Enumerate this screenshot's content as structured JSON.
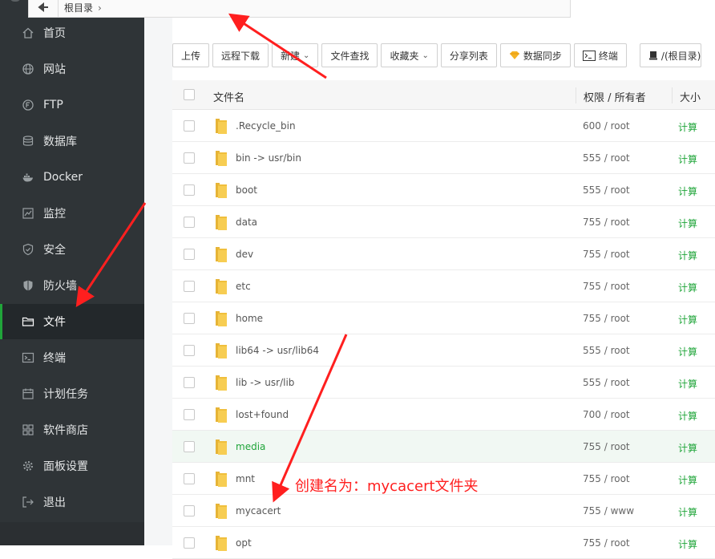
{
  "sidebar": {
    "items": [
      {
        "label": "首页",
        "icon": "home-icon"
      },
      {
        "label": "网站",
        "icon": "globe-icon"
      },
      {
        "label": "FTP",
        "icon": "ftp-icon"
      },
      {
        "label": "数据库",
        "icon": "database-icon"
      },
      {
        "label": "Docker",
        "icon": "docker-icon"
      },
      {
        "label": "监控",
        "icon": "monitor-icon"
      },
      {
        "label": "安全",
        "icon": "shield-icon"
      },
      {
        "label": "防火墙",
        "icon": "firewall-icon"
      },
      {
        "label": "文件",
        "icon": "folder-icon",
        "active": true
      },
      {
        "label": "终端",
        "icon": "terminal-icon"
      },
      {
        "label": "计划任务",
        "icon": "calendar-icon"
      },
      {
        "label": "软件商店",
        "icon": "apps-icon"
      },
      {
        "label": "面板设置",
        "icon": "gear-icon"
      },
      {
        "label": "退出",
        "icon": "logout-icon"
      }
    ]
  },
  "pathbar": {
    "root_label": "根目录"
  },
  "toolbar": {
    "upload": "上传",
    "remote_download": "远程下载",
    "new": "新建",
    "file_search": "文件查找",
    "favorites": "收藏夹",
    "share_list": "分享列表",
    "data_sync": "数据同步",
    "terminal": "终端",
    "disk": "/(根目录)"
  },
  "table": {
    "headers": {
      "name": "文件名",
      "perm": "权限 / 所有者",
      "size": "大小"
    },
    "rows": [
      {
        "name": ".Recycle_bin",
        "perm": "600 / root",
        "size": "计算"
      },
      {
        "name": "bin -> usr/bin",
        "perm": "555 / root",
        "size": "计算"
      },
      {
        "name": "boot",
        "perm": "555 / root",
        "size": "计算"
      },
      {
        "name": "data",
        "perm": "755 / root",
        "size": "计算"
      },
      {
        "name": "dev",
        "perm": "755 / root",
        "size": "计算"
      },
      {
        "name": "etc",
        "perm": "755 / root",
        "size": "计算"
      },
      {
        "name": "home",
        "perm": "755 / root",
        "size": "计算"
      },
      {
        "name": "lib64 -> usr/lib64",
        "perm": "555 / root",
        "size": "计算"
      },
      {
        "name": "lib -> usr/lib",
        "perm": "555 / root",
        "size": "计算"
      },
      {
        "name": "lost+found",
        "perm": "700 / root",
        "size": "计算"
      },
      {
        "name": "media",
        "perm": "755 / root",
        "size": "计算",
        "highlight": true
      },
      {
        "name": "mnt",
        "perm": "755 / root",
        "size": "计算"
      },
      {
        "name": "mycacert",
        "perm": "755 / www",
        "size": "计算"
      },
      {
        "name": "opt",
        "perm": "755 / root",
        "size": "计算"
      }
    ]
  },
  "annotation": {
    "text": "创建名为：mycacert文件夹"
  },
  "colors": {
    "accent": "#20a53a",
    "sidebar_bg": "#2f3437",
    "annotation": "#ff1f1f"
  }
}
